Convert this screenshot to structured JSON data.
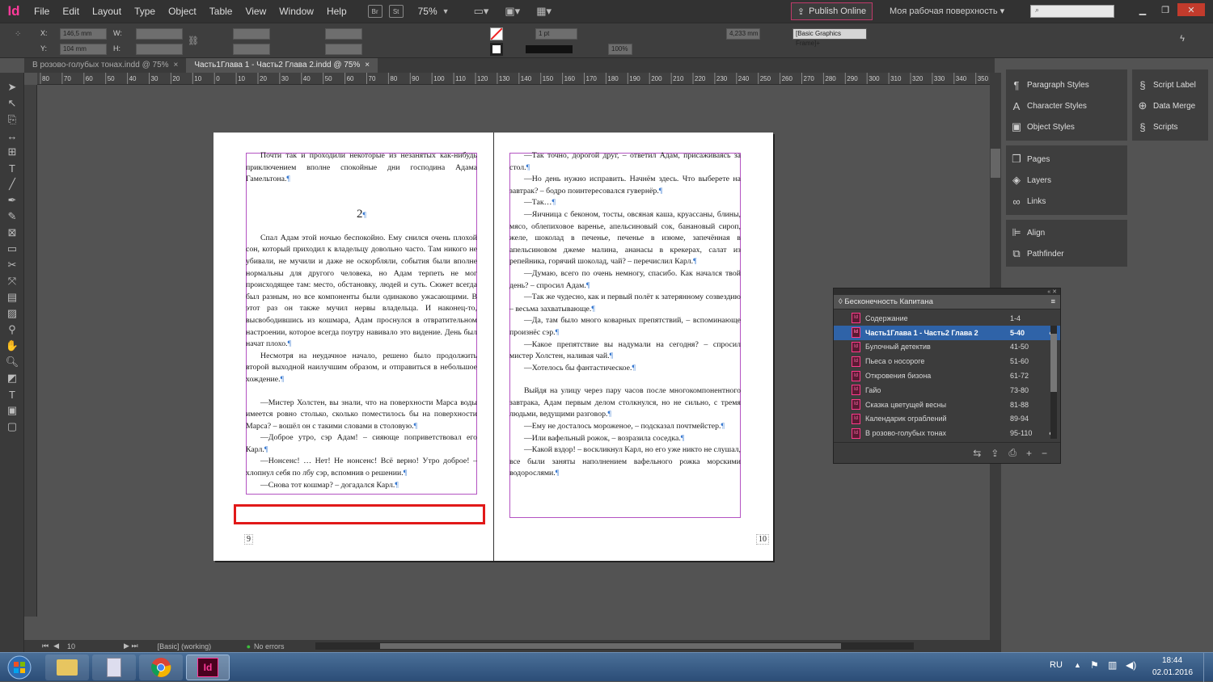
{
  "menubar": {
    "logo": "Id",
    "items": [
      "File",
      "Edit",
      "Layout",
      "Type",
      "Object",
      "Table",
      "View",
      "Window",
      "Help"
    ],
    "btn_br": "Br",
    "btn_st": "St",
    "zoom": "75%",
    "publish": "Publish Online",
    "workspace": "Моя рабочая поверхность",
    "search_placeholder": ""
  },
  "control": {
    "x_label": "X:",
    "x_value": "146,5 mm",
    "y_label": "Y:",
    "y_value": "104 mm",
    "w_label": "W:",
    "h_label": "H:",
    "stroke": "1 pt",
    "percent": "100%",
    "measure": "4,233 mm",
    "frame_style": "[Basic Graphics Frame]+"
  },
  "tabs": [
    {
      "label": "В розово-голубых тонах.indd @ 75%",
      "close": "×"
    },
    {
      "label": "Часть1Глава 1 - Часть2 Глава 2.indd @ 75%",
      "close": "×"
    }
  ],
  "ruler_ticks": [
    "80",
    "70",
    "60",
    "50",
    "40",
    "30",
    "20",
    "10",
    "0",
    "10",
    "20",
    "30",
    "40",
    "50",
    "60",
    "70",
    "80",
    "90",
    "100",
    "110",
    "120",
    "130",
    "140",
    "150",
    "160",
    "170",
    "180",
    "190",
    "200",
    "210",
    "220",
    "230",
    "240",
    "250",
    "260",
    "270",
    "280",
    "290",
    "300",
    "310",
    "320",
    "330",
    "340",
    "350"
  ],
  "left_page": {
    "para1": "Почти так и проходили некоторые из незанятых как-нибудь приключением вполне спокойные дни господина Адама Гамельтона.",
    "chapter": "2",
    "para2": "Спал Адам этой ночью беспокойно. Ему снился очень плохой сон, который приходил к владельцу довольно часто. Там никого не убивали, не мучили и даже не оскорбляли, события были вполне нормальны для другого человека, но Адам терпеть не мог происходящее там: место, обстановку, людей и суть. Сюжет всегда был разным, но все компоненты были одинаково ужасающими. В этот раз он также мучил нервы владельца. И наконец-то, высвободившись из кошмара, Адам проснулся в отвратительном настроении, которое всегда поутру навивало это видение. День был начат плохо.",
    "para3": "Несмотря на неудачное начало, решено было продолжить второй выходной наилучшим образом, и отправиться в небольшое хождение.",
    "para4": "—Мистер Холстен, вы знали, что на поверхности Марса воды имеется ровно столько, сколько поместилось бы на поверхности Марса? – вошёл он с такими словами в столовую.",
    "para5": "—Доброе утро, сэр Адам! – сияюще поприветствовал его Карл.",
    "para6": "—Нонсенс! … Нет! Не нонсенс! Всё верно! Утро доброе! – хлопнул себя по лбу сэр, вспомнив о решении.",
    "para7": "—Снова тот кошмар? – догадался Карл.",
    "page_number": "9"
  },
  "right_page": {
    "lines": [
      "—Так точно, дорогой друг, – ответил Адам, присаживаясь за стол.",
      "—Но день нужно исправить. Начнём здесь. Что выберете на завтрак? – бодро поинтересовался гувернёр.",
      "—Так…",
      "—Яичница с беконом, тосты, овсяная каша, круассаны, блины, мясо, облепиховое варенье, апельсиновый сок, банановый сироп, желе, шоколад в печенье, печенье в изюме, запечённая в апельсиновом джеме малина, ананасы в крекерах, салат из репейника, горячий шоколад, чай? – перечислил Карл.",
      "—Думаю, всего по очень немногу, спасибо. Как начался твой день? – спросил Адам.",
      "—Так же чудесно, как и первый полёт к затерянному созвездию – весьма захватывающе.",
      "—Да, там было много коварных препятствий, – вспоминающе произнёс сэр.",
      "—Какое препятствие вы надумали на сегодня? – спросил мистер Холстен, наливая чай.",
      "—Хотелось бы фантастическое."
    ],
    "para_after": "Выйдя на улицу через пару часов после многокомпонентного завтрака, Адам первым делом столкнулся, но не сильно, с тремя людьми, ведущими разговор.",
    "lines2": [
      "—Ему не досталось мороженое, – подсказал почтмейстер.",
      "—Или вафельный рожок, – возразила соседка.",
      "—Какой вздор! – воскликнул Карл, но его уже никто не слушал, все были заняты наполнением вафельного рожка морскими водорослями."
    ],
    "page_number": "10"
  },
  "panels": {
    "group1": [
      "Paragraph Styles",
      "Character Styles",
      "Object Styles"
    ],
    "group2": [
      "Script Label",
      "Data Merge",
      "Scripts"
    ],
    "group3": [
      "Pages",
      "Layers",
      "Links"
    ],
    "group4": [
      "Align",
      "Pathfinder"
    ]
  },
  "book_panel": {
    "title": "Бесконечность Капитана",
    "rows": [
      {
        "name": "Содержание",
        "pages": "1-4",
        "dot": ""
      },
      {
        "name": "Часть1Глава 1 - Часть2 Глава 2",
        "pages": "5-40",
        "dot": "●"
      },
      {
        "name": "Булочный детектив",
        "pages": "41-50",
        "dot": ""
      },
      {
        "name": "Пьеса о носороге",
        "pages": "51-60",
        "dot": ""
      },
      {
        "name": "Откровения бизона",
        "pages": "61-72",
        "dot": ""
      },
      {
        "name": "Гайо",
        "pages": "73-80",
        "dot": ""
      },
      {
        "name": "Сказка цветущей весны",
        "pages": "81-88",
        "dot": ""
      },
      {
        "name": "Календарик ограблений",
        "pages": "89-94",
        "dot": ""
      },
      {
        "name": "В розово-голубых тонах",
        "pages": "95-110",
        "dot": "●"
      }
    ]
  },
  "status": {
    "page": "10",
    "mode": "[Basic] (working)",
    "errors": "No errors"
  },
  "taskbar": {
    "lang": "RU",
    "time": "18:44",
    "date": "02.01.2016"
  },
  "colors": {
    "accent": "#ff3a9a",
    "frame": "#b453c2",
    "highlight": "#e11919",
    "selected": "#2f63a8"
  }
}
